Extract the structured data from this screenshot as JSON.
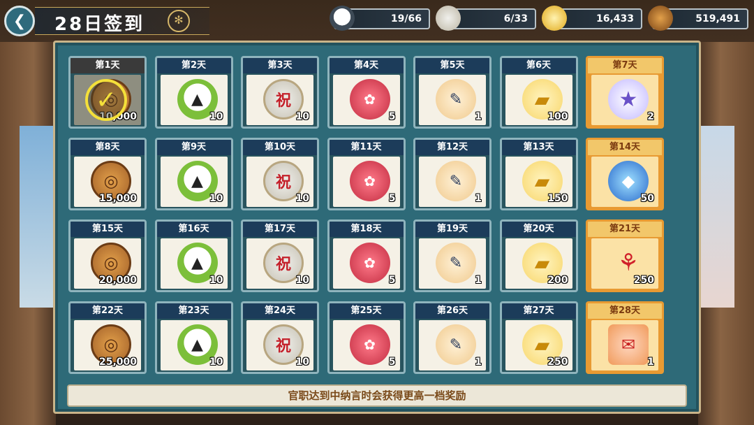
{
  "header": {
    "back_icon": "chevron-left-icon",
    "title": "28日签到",
    "emblem_icon": "crest-icon"
  },
  "resources": [
    {
      "name": "onigiri",
      "icon": "onigiri-icon",
      "value": "19/66"
    },
    {
      "name": "sake-barrel",
      "icon": "sake-barrel-icon",
      "value": "6/33"
    },
    {
      "name": "gold-bar",
      "icon": "gold-bar-icon",
      "value": "16,433"
    },
    {
      "name": "coin",
      "icon": "coin-icon",
      "value": "519,491"
    }
  ],
  "days": [
    {
      "label": "第1天",
      "item": "coin",
      "qty": "10,000",
      "claimed": true
    },
    {
      "label": "第2天",
      "item": "onigiri",
      "qty": "10"
    },
    {
      "label": "第3天",
      "item": "sake",
      "qty": "10"
    },
    {
      "label": "第4天",
      "item": "bag",
      "qty": "5"
    },
    {
      "label": "第5天",
      "item": "scroll",
      "qty": "1"
    },
    {
      "label": "第6天",
      "item": "gold",
      "qty": "100"
    },
    {
      "label": "第7天",
      "item": "star",
      "qty": "2",
      "special": true
    },
    {
      "label": "第8天",
      "item": "coin",
      "qty": "15,000"
    },
    {
      "label": "第9天",
      "item": "onigiri",
      "qty": "10"
    },
    {
      "label": "第10天",
      "item": "sake",
      "qty": "10"
    },
    {
      "label": "第11天",
      "item": "bag",
      "qty": "5"
    },
    {
      "label": "第12天",
      "item": "scroll",
      "qty": "1"
    },
    {
      "label": "第13天",
      "item": "gold",
      "qty": "150"
    },
    {
      "label": "第14天",
      "item": "orb",
      "qty": "50",
      "special": true
    },
    {
      "label": "第15天",
      "item": "coin",
      "qty": "20,000"
    },
    {
      "label": "第16天",
      "item": "onigiri",
      "qty": "10"
    },
    {
      "label": "第17天",
      "item": "sake",
      "qty": "10"
    },
    {
      "label": "第18天",
      "item": "bag",
      "qty": "5"
    },
    {
      "label": "第19天",
      "item": "scroll",
      "qty": "1"
    },
    {
      "label": "第20天",
      "item": "gold",
      "qty": "200"
    },
    {
      "label": "第21天",
      "item": "ribbon",
      "qty": "250",
      "special": true
    },
    {
      "label": "第22天",
      "item": "coin",
      "qty": "25,000"
    },
    {
      "label": "第23天",
      "item": "onigiri",
      "qty": "10"
    },
    {
      "label": "第24天",
      "item": "sake",
      "qty": "10"
    },
    {
      "label": "第25天",
      "item": "bag",
      "qty": "5"
    },
    {
      "label": "第26天",
      "item": "scroll",
      "qty": "1"
    },
    {
      "label": "第27天",
      "item": "gold",
      "qty": "250"
    },
    {
      "label": "第28天",
      "item": "tag",
      "qty": "1",
      "special": true
    }
  ],
  "icons": {
    "coin": {
      "name": "coin-icon",
      "glyph": "◎"
    },
    "onigiri": {
      "name": "onigiri-icon",
      "glyph": "▲"
    },
    "sake": {
      "name": "sake-barrel-icon",
      "glyph": "祝"
    },
    "bag": {
      "name": "lucky-bag-icon",
      "glyph": "✿"
    },
    "scroll": {
      "name": "scroll-icon",
      "glyph": "✎"
    },
    "gold": {
      "name": "gold-bar-icon",
      "glyph": "▰"
    },
    "star": {
      "name": "star-icon",
      "glyph": "★"
    },
    "orb": {
      "name": "crystal-orb-icon",
      "glyph": "◆"
    },
    "ribbon": {
      "name": "ribbon-icon",
      "glyph": "⚘"
    },
    "tag": {
      "name": "daruma-tag-icon",
      "glyph": "✉"
    }
  },
  "check_icon": "checkmark-icon",
  "notice": "官职达到中纳言时会获得更高一档奖励"
}
